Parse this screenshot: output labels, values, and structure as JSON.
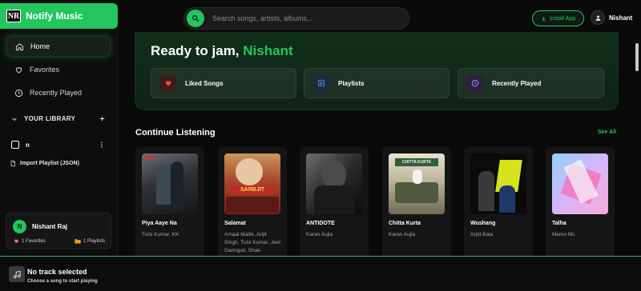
{
  "app": {
    "logo_text": "NR",
    "name": "Notify Music"
  },
  "nav": [
    {
      "label": "Home"
    },
    {
      "label": "Favorites"
    },
    {
      "label": "Recently Played"
    }
  ],
  "library": {
    "heading": "YOUR LIBRARY",
    "playlist": "n",
    "import_label": "Import Playlist (JSON)"
  },
  "user": {
    "initial": "N",
    "name": "Nishant Raj",
    "favorites": "1 Favorites",
    "playlists": "1 Playlists"
  },
  "search": {
    "placeholder": "Search songs, artists, albums..."
  },
  "topbar": {
    "install_label": "Install App",
    "profile_name": "Nishant"
  },
  "hero": {
    "greeting": "Ready to jam,",
    "name": "Nishant",
    "quick": [
      {
        "label": "Liked Songs",
        "icon": "heart-icon",
        "color": "#ef4444",
        "bg": "#3a1d1d"
      },
      {
        "label": "Playlists",
        "icon": "list-icon",
        "color": "#60a5fa",
        "bg": "#1d2a40"
      },
      {
        "label": "Recently Played",
        "icon": "clock-icon",
        "color": "#a78bfa",
        "bg": "#2c2040"
      }
    ]
  },
  "continue": {
    "title": "Continue Listening",
    "see_all": "See All",
    "cards": [
      {
        "title": "Piya Aaye Na",
        "artist": "Tulsi Kumar, KK"
      },
      {
        "title": "Salamat",
        "artist": "Amaal Mallik, Arijit Singh, Tulsi Kumar, Jeet Gannguli, Shail-"
      },
      {
        "title": "ANTIDOTE",
        "artist": "Karan Aujla"
      },
      {
        "title": "Chitta Kurta",
        "artist": "Karan Aujla"
      },
      {
        "title": "Wushang",
        "artist": "Arpit Bala"
      },
      {
        "title": "Talha",
        "artist": "Memo Mc"
      }
    ]
  },
  "player": {
    "title": "No track selected",
    "subtitle": "Choose a song to start playing"
  },
  "colors": {
    "accent": "#22c55e"
  }
}
